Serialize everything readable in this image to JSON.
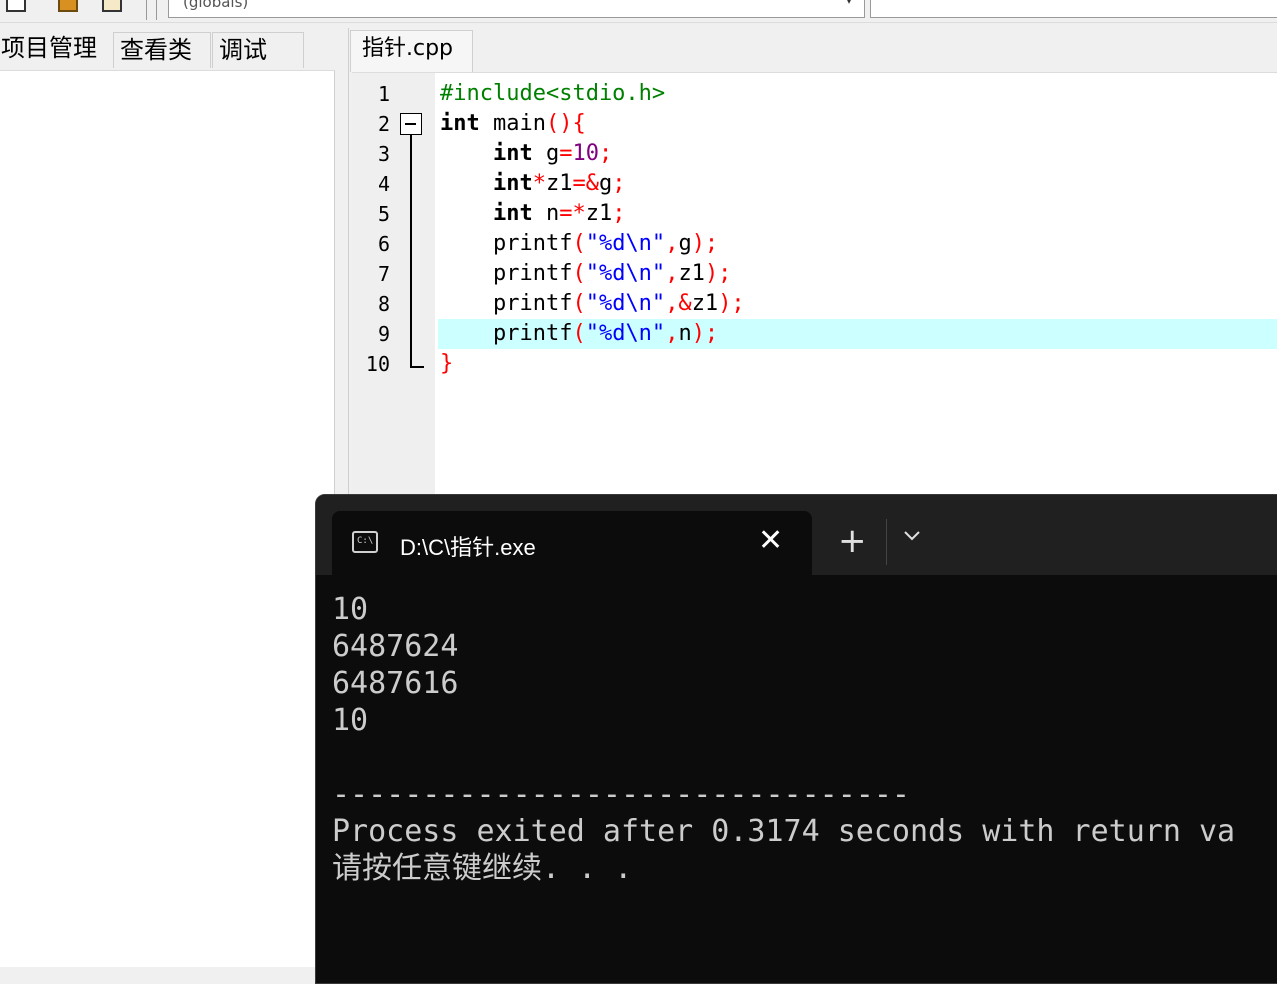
{
  "toolbar": {
    "scope_value": "(globals)"
  },
  "left_tabs": [
    "项目管理",
    "查看类",
    "调试"
  ],
  "editor": {
    "tab_label": "指针.cpp",
    "line_numbers": [
      "1",
      "2",
      "3",
      "4",
      "5",
      "6",
      "7",
      "8",
      "9",
      "10"
    ],
    "highlight_line": 9,
    "lines": [
      [
        {
          "t": "#include<stdio.h>",
          "c": "#008000"
        }
      ],
      [
        {
          "t": "int",
          "c": "#000000",
          "b": true
        },
        {
          "t": " main",
          "c": "#000000"
        },
        {
          "t": "(){",
          "c": "#ff0000"
        }
      ],
      [
        {
          "t": "    ",
          "c": "#000000"
        },
        {
          "t": "int",
          "c": "#000000",
          "b": true
        },
        {
          "t": " g",
          "c": "#000000"
        },
        {
          "t": "=",
          "c": "#ff0000"
        },
        {
          "t": "10",
          "c": "#800080"
        },
        {
          "t": ";",
          "c": "#ff0000"
        }
      ],
      [
        {
          "t": "    ",
          "c": "#000000"
        },
        {
          "t": "int",
          "c": "#000000",
          "b": true
        },
        {
          "t": "*",
          "c": "#ff0000"
        },
        {
          "t": "z1",
          "c": "#000000"
        },
        {
          "t": "=&",
          "c": "#ff0000"
        },
        {
          "t": "g",
          "c": "#000000"
        },
        {
          "t": ";",
          "c": "#ff0000"
        }
      ],
      [
        {
          "t": "    ",
          "c": "#000000"
        },
        {
          "t": "int",
          "c": "#000000",
          "b": true
        },
        {
          "t": " n",
          "c": "#000000"
        },
        {
          "t": "=*",
          "c": "#ff0000"
        },
        {
          "t": "z1",
          "c": "#000000"
        },
        {
          "t": ";",
          "c": "#ff0000"
        }
      ],
      [
        {
          "t": "    printf",
          "c": "#000000"
        },
        {
          "t": "(",
          "c": "#ff0000"
        },
        {
          "t": "\"%d\\n\"",
          "c": "#0000ff"
        },
        {
          "t": ",",
          "c": "#ff0000"
        },
        {
          "t": "g",
          "c": "#000000"
        },
        {
          "t": ");",
          "c": "#ff0000"
        }
      ],
      [
        {
          "t": "    printf",
          "c": "#000000"
        },
        {
          "t": "(",
          "c": "#ff0000"
        },
        {
          "t": "\"%d\\n\"",
          "c": "#0000ff"
        },
        {
          "t": ",",
          "c": "#ff0000"
        },
        {
          "t": "z1",
          "c": "#000000"
        },
        {
          "t": ");",
          "c": "#ff0000"
        }
      ],
      [
        {
          "t": "    printf",
          "c": "#000000"
        },
        {
          "t": "(",
          "c": "#ff0000"
        },
        {
          "t": "\"%d\\n\"",
          "c": "#0000ff"
        },
        {
          "t": ",&",
          "c": "#ff0000"
        },
        {
          "t": "z1",
          "c": "#000000"
        },
        {
          "t": ");",
          "c": "#ff0000"
        }
      ],
      [
        {
          "t": "    printf",
          "c": "#000000"
        },
        {
          "t": "(",
          "c": "#ff0000"
        },
        {
          "t": "\"%d\\n\"",
          "c": "#0000ff"
        },
        {
          "t": ",",
          "c": "#ff0000"
        },
        {
          "t": "n",
          "c": "#000000"
        },
        {
          "t": ");",
          "c": "#ff0000"
        }
      ],
      [
        {
          "t": "}",
          "c": "#ff0000"
        }
      ]
    ]
  },
  "terminal": {
    "tab_title": "D:\\C\\指针.exe",
    "icon_label": "C:\\",
    "close_glyph": "✕",
    "new_tab_glyph": "+",
    "output_lines": [
      "10",
      "6487624",
      "6487616",
      "10",
      "",
      "--------------------------------",
      "Process exited after 0.3174 seconds with return va",
      "请按任意键继续. . ."
    ]
  }
}
